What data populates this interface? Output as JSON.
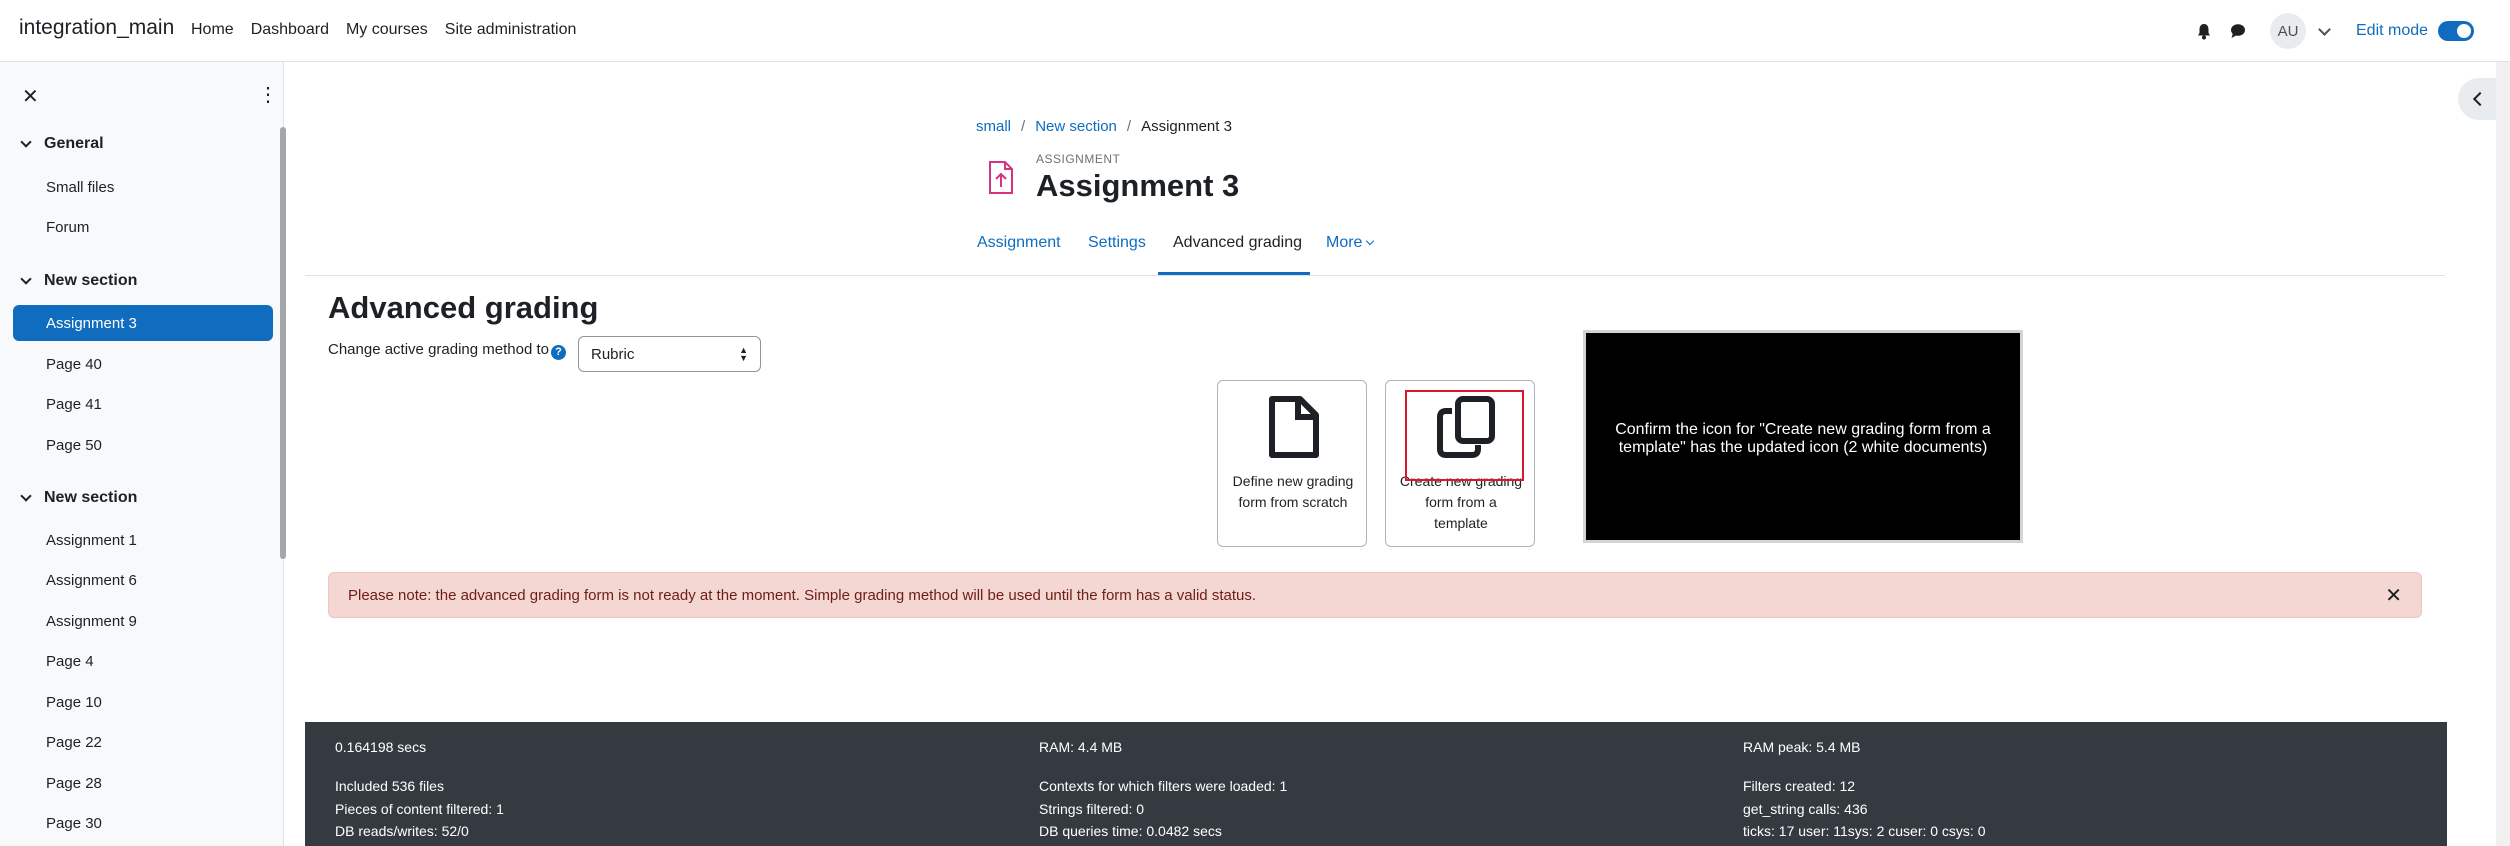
{
  "navbar": {
    "brand": "integration_main",
    "links": [
      "Home",
      "Dashboard",
      "My courses",
      "Site administration"
    ],
    "avatar": "AU",
    "edit_mode": "Edit mode",
    "icons": [
      "bell-icon",
      "chat-icon"
    ]
  },
  "drawer": {
    "sections": [
      {
        "title": "General",
        "items": [
          "Small files",
          "Forum"
        ]
      },
      {
        "title": "New section",
        "items": [
          "Assignment 3",
          "Page 40",
          "Page 41",
          "Page 50"
        ]
      },
      {
        "title": "New section",
        "items": [
          "Assignment 1",
          "Assignment 6",
          "Assignment 9",
          "Page 4",
          "Page 10",
          "Page 22",
          "Page 28",
          "Page 30"
        ]
      }
    ],
    "active_item": "Assignment 3"
  },
  "breadcrumb": [
    "small",
    "New section",
    "Assignment 3"
  ],
  "activity": {
    "type": "ASSIGNMENT",
    "title": "Assignment 3"
  },
  "tabs": [
    "Assignment",
    "Settings",
    "Advanced grading",
    "More"
  ],
  "active_tab": "Advanced grading",
  "main": {
    "heading": "Advanced grading",
    "method_label": "Change active grading method to",
    "method_value": "Rubric",
    "cards": [
      {
        "label": "Define new grading form from scratch",
        "icon": "document-icon"
      },
      {
        "label": "Create new grading form from a template",
        "icon": "copy-documents-icon"
      }
    ],
    "overlay_message": "Confirm the icon for \"Create new grading form from a template\" has the updated icon (2 white documents)",
    "alert": "Please note: the advanced grading form is not ready at the moment. Simple grading method will be used until the form has a valid status."
  },
  "footer": {
    "col1": [
      "0.164198 secs",
      "Included 536 files",
      "Pieces of content filtered: 1",
      "DB reads/writes: 52/0"
    ],
    "col2": [
      "RAM: 4.4 MB",
      "Contexts for which filters were loaded: 1",
      "Strings filtered: 0",
      "DB queries time: 0.0482 secs"
    ],
    "col3": [
      "RAM peak: 5.4 MB",
      "Filters created: 12",
      "get_string calls: 436",
      "ticks: 17 user: 11sys: 2 cuser: 0 csys: 0"
    ]
  },
  "colors": {
    "accent": "#0f6cbf",
    "alert_bg": "#f4d6d2",
    "footer_bg": "#343a40"
  }
}
